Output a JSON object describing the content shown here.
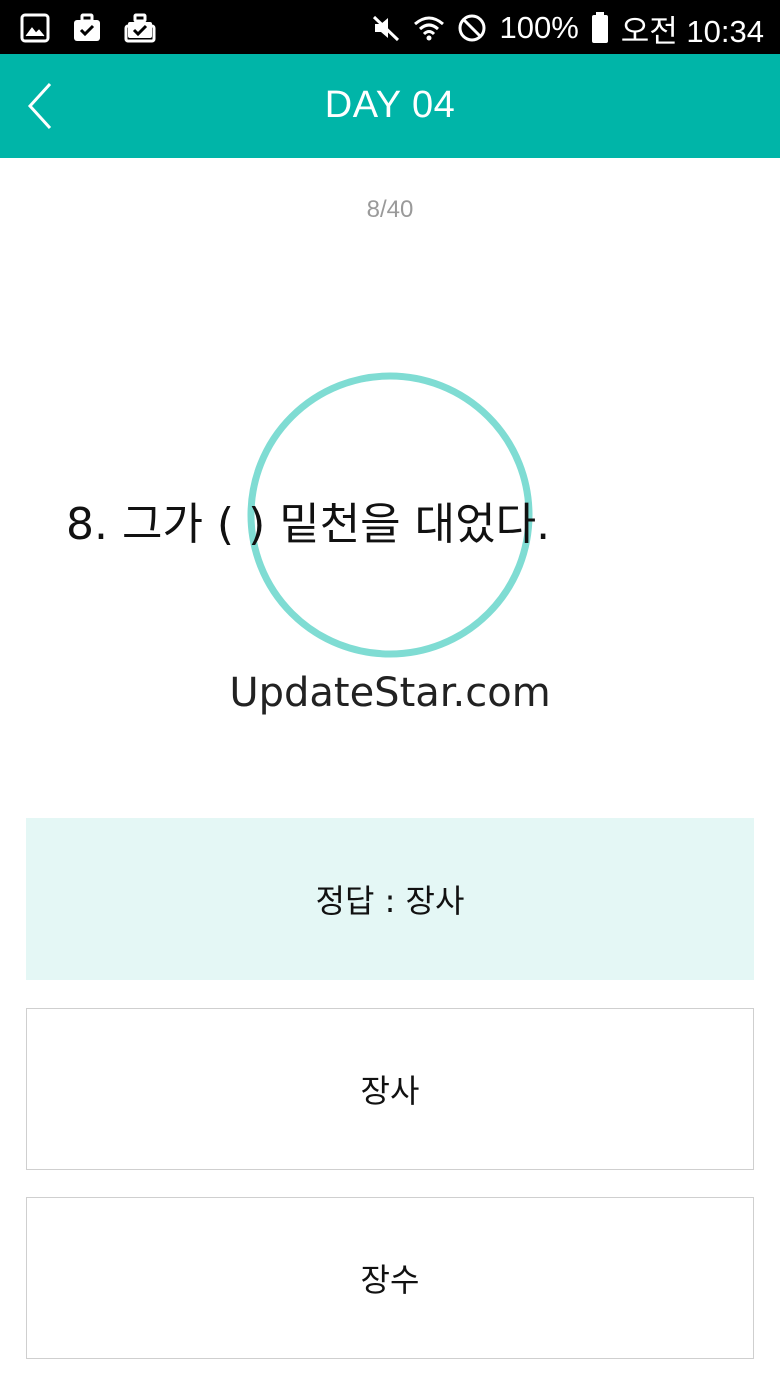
{
  "status_bar": {
    "battery": "100%",
    "time": "오전 10:34",
    "left_icons": [
      "gallery-icon",
      "briefcase-check-icon",
      "briefcase-stack-icon"
    ],
    "right_icons": [
      "mute-icon",
      "wifi-icon",
      "no-sync-icon",
      "battery-icon"
    ]
  },
  "header": {
    "title": "DAY 04",
    "back_icon": "chevron-left-icon",
    "color": "#00b5a8"
  },
  "quiz": {
    "progress": "8/40",
    "question": "8. 그가 ( ) 밑천을 대었다.",
    "answer": "정답 : 장사",
    "options": [
      "장사",
      "장수"
    ]
  },
  "overlay": {
    "watermark": "UpdateStar.com",
    "ring_color": "#7fdcd3"
  },
  "colors": {
    "answer_bg": "#e4f7f5",
    "option_border": "#cfcfcf"
  }
}
